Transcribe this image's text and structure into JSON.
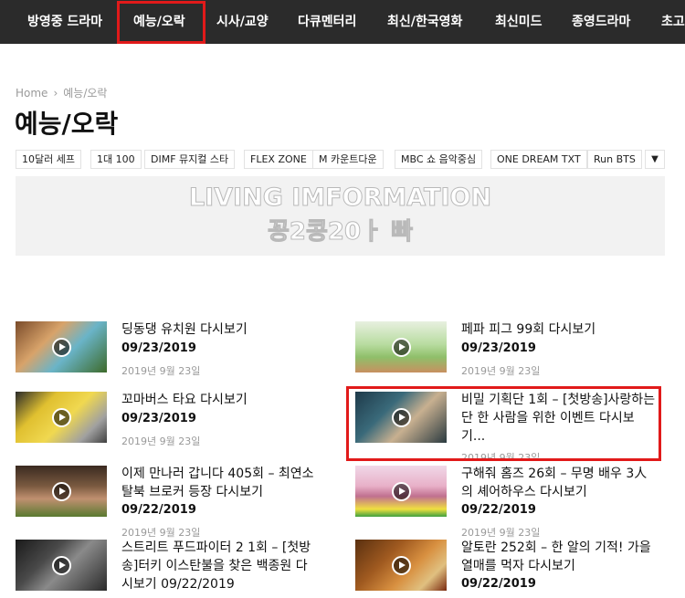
{
  "nav": {
    "items": [
      "방영중 드라마",
      "예능/오락",
      "시사/교양",
      "다큐멘터리",
      "최신/한국영화",
      "최신미드",
      "종영드라마",
      "초고"
    ],
    "active_index": 1
  },
  "breadcrumb": {
    "home": "Home",
    "sep": "›",
    "current": "예능/오락"
  },
  "page_title": "예능/오락",
  "tags": [
    "10달러 세프",
    "1대 100",
    "DIMF 뮤지컬 스타",
    "FLEX ZONE",
    "M 카운트다운",
    "MBC 쇼 음악중심",
    "ONE DREAM TXT",
    "Run BTS"
  ],
  "tag_toggle_icon": "chevron-down-icon",
  "banner": {
    "line1": "LIVING IMFORMATION",
    "line2": "꽁2콩20ㅏ 빠"
  },
  "posts": [
    {
      "title": "딩동댕 유치원 다시보기",
      "date_bold": "09/23/2019",
      "date": "2019년 9월 23일"
    },
    {
      "title": "페파 피그 99회 다시보기",
      "date_bold": "09/23/2019",
      "date": "2019년 9월 23일"
    },
    {
      "title": "꼬마버스 타요 다시보기",
      "date_bold": "09/23/2019",
      "date": "2019년 9월 23일"
    },
    {
      "title": "비밀 기획단 1회 – [첫방송]사랑하는 단 한 사람을 위한 이벤트 다시보기...",
      "date_bold": "",
      "date": "2019년 9월 23일"
    },
    {
      "title": "이제 만나러 갑니다 405회 – 최연소 탈북 브로커 등장 다시보기",
      "date_bold": "09/22/2019",
      "date": "2019년 9월 23일"
    },
    {
      "title": "구해줘 홈즈 26회 – 무명 배우 3人의 셰어하우스 다시보기",
      "date_bold": "09/22/2019",
      "date": "2019년 9월 23일"
    },
    {
      "title": "스트리트 푸드파이터 2 1회 – [첫방송]터키 이스탄불을 찾은 백종원 다시보기 09/22/2019",
      "date_bold": "",
      "date": ""
    },
    {
      "title": "알토란 252회 – 한 알의 기적! 가을 열매를 먹자 다시보기",
      "date_bold": "09/22/2019",
      "date": ""
    }
  ],
  "colors": {
    "nav_bg": "#2b2b2b",
    "highlight": "#e11a1a",
    "banner_bg": "#f2f2f2"
  }
}
